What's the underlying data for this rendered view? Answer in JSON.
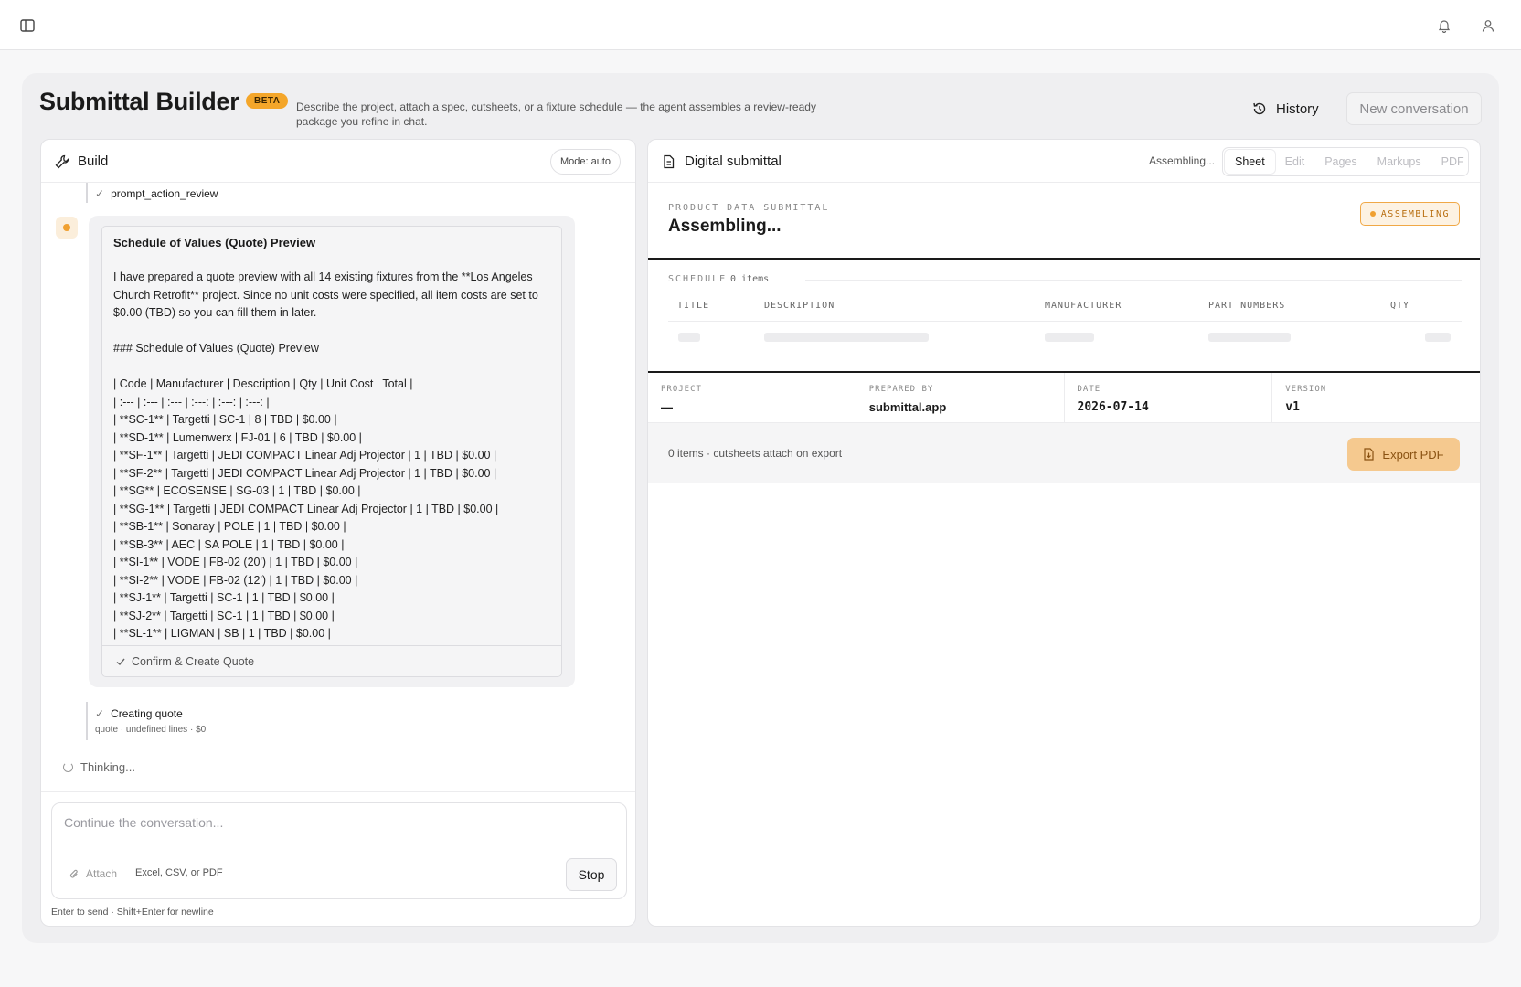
{
  "topbar": {
    "sidebar_toggle_icon": "sidebar-toggle-icon",
    "bell_icon": "bell-icon",
    "user_icon": "user-icon"
  },
  "header": {
    "title": "Submittal Builder",
    "badge": "BETA",
    "subtitle": "Describe the project, attach a spec, cutsheets, or a fixture schedule — the agent assembles a review-ready package you refine in chat.",
    "history_label": "History",
    "new_conversation_label": "New conversation"
  },
  "build": {
    "title": "Build",
    "mode": "Mode: auto",
    "tool_top": "prompt_action_review",
    "card_title": "Schedule of Values (Quote) Preview",
    "message_lines": [
      "I have prepared a quote preview with all 14 existing fixtures from the **Los Angeles Church Retrofit** project. Since no unit costs were specified, all item costs are set to $0.00 (TBD) so you can fill them in later.",
      "",
      "### Schedule of Values (Quote) Preview",
      "",
      "| Code | Manufacturer | Description | Qty | Unit Cost | Total |",
      "| :--- | :--- | :--- | :---: | :---: | :---: |",
      "| **SC-1** | Targetti | SC-1 | 8 | TBD | $0.00 |",
      "| **SD-1** | Lumenwerx | FJ-01 | 6 | TBD | $0.00 |",
      "| **SF-1** | Targetti | JEDI COMPACT Linear Adj Projector | 1 | TBD | $0.00 |",
      "| **SF-2** | Targetti | JEDI COMPACT Linear Adj Projector | 1 | TBD | $0.00 |",
      "| **SG** | ECOSENSE | SG-03 | 1 | TBD | $0.00 |",
      "| **SG-1** | Targetti | JEDI COMPACT Linear Adj Projector | 1 | TBD | $0.00 |",
      "| **SB-1** | Sonaray | POLE | 1 | TBD | $0.00 |",
      "| **SB-3** | AEC | SA POLE | 1 | TBD | $0.00 |",
      "| **SI-1** | VODE | FB-02 (20') | 1 | TBD | $0.00 |",
      "| **SI-2** | VODE | FB-02 (12') | 1 | TBD | $0.00 |",
      "| **SJ-1** | Targetti | SC-1 | 1 | TBD | $0.00 |",
      "| **SJ-2** | Targetti | SC-1 | 1 | TBD | $0.00 |",
      "| **SL-1** | LIGMAN | SB | 1 | TBD | $0.00 |"
    ],
    "confirm_label": "Confirm & Create Quote",
    "tool_bottom": "Creating quote",
    "tool_bottom_sub": "quote · undefined lines · $0",
    "thinking": "Thinking...",
    "composer_placeholder": "Continue the conversation...",
    "attach_label": "Attach",
    "attach_hint": "Excel, CSV, or PDF",
    "stop_label": "Stop",
    "hint": "Enter to send · Shift+Enter for newline"
  },
  "submittal": {
    "title": "Digital submittal",
    "status": "Assembling...",
    "tabs": [
      "Sheet",
      "Edit",
      "Pages",
      "Markups",
      "PDF"
    ],
    "active_tab": "Sheet",
    "kicker": "PRODUCT DATA SUBMITTAL",
    "sheet_title": "Assembling...",
    "badge": "ASSEMBLING",
    "schedule_label": "SCHEDULE",
    "schedule_count": "0 items",
    "columns": [
      "TITLE",
      "DESCRIPTION",
      "MANUFACTURER",
      "PART NUMBERS",
      "QTY"
    ],
    "meta": [
      {
        "label": "PROJECT",
        "value": "—"
      },
      {
        "label": "PREPARED BY",
        "value": "submittal.app"
      },
      {
        "label": "DATE",
        "value": "2026-07-14"
      },
      {
        "label": "VERSION",
        "value": "v1"
      }
    ],
    "footer_text": "0 items · cutsheets attach on export",
    "export_label": "Export PDF"
  },
  "colors": {
    "accent": "#f4a62a",
    "export_bg": "#f5c98f",
    "badge_text": "#b86e10"
  }
}
